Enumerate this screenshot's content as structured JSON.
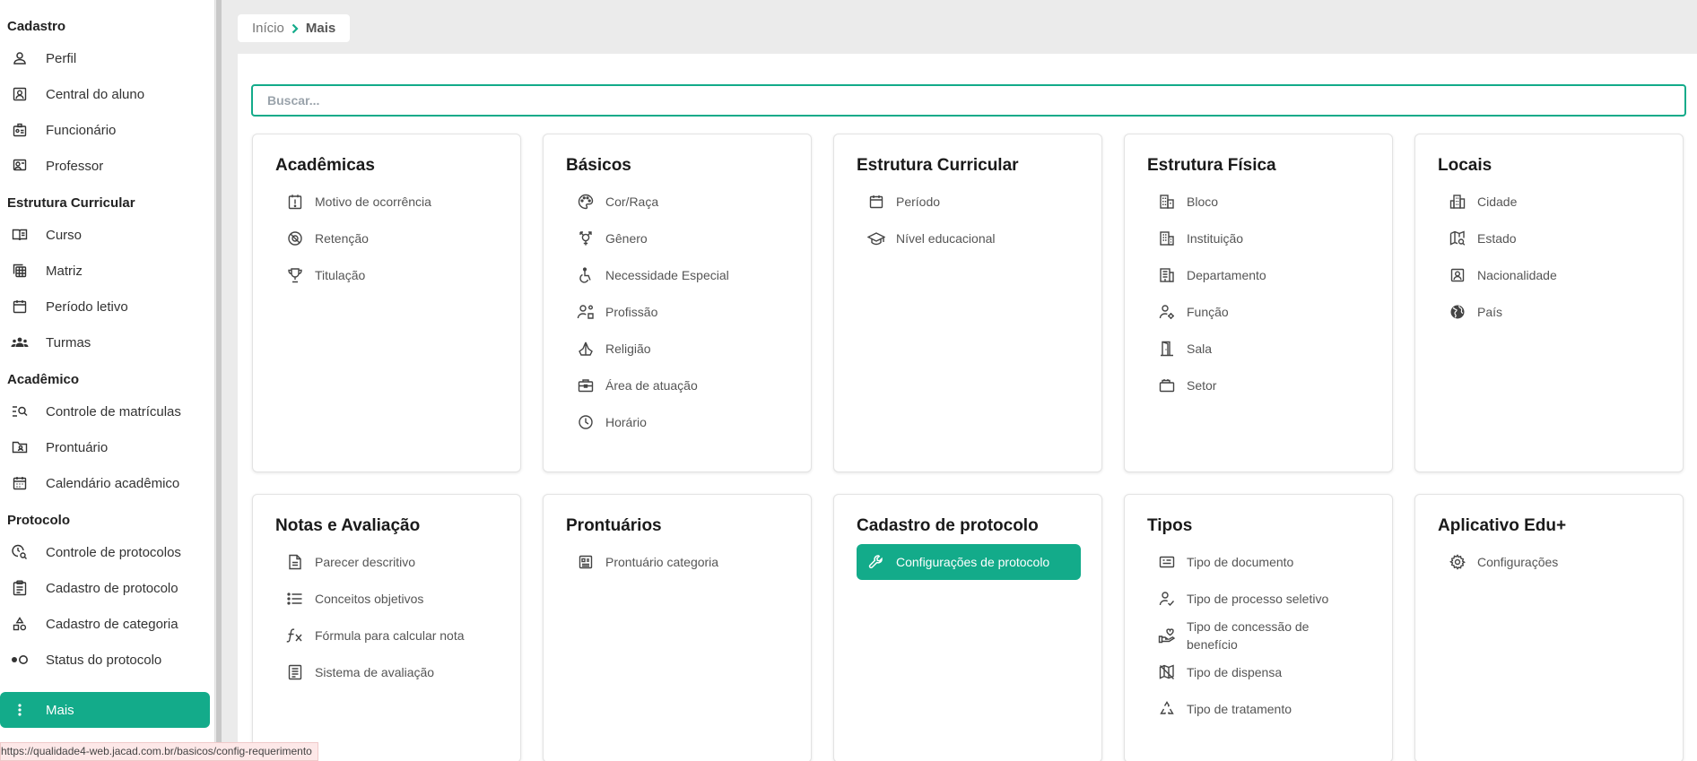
{
  "sidebar": {
    "sections": [
      {
        "title": "Cadastro",
        "items": [
          {
            "label": "Perfil",
            "icon": "person-icon"
          },
          {
            "label": "Central do aluno",
            "icon": "student-portrait-icon"
          },
          {
            "label": "Funcionário",
            "icon": "badge-icon"
          },
          {
            "label": "Professor",
            "icon": "teacher-icon"
          }
        ]
      },
      {
        "title": "Estrutura Curricular",
        "items": [
          {
            "label": "Curso",
            "icon": "book-open-icon"
          },
          {
            "label": "Matriz",
            "icon": "grid-stack-icon"
          },
          {
            "label": "Período letivo",
            "icon": "calendar-icon"
          },
          {
            "label": "Turmas",
            "icon": "group-icon"
          }
        ]
      },
      {
        "title": "Acadêmico",
        "items": [
          {
            "label": "Controle de matrículas",
            "icon": "list-search-icon"
          },
          {
            "label": "Prontuário",
            "icon": "folder-user-icon"
          },
          {
            "label": "Calendário acadêmico",
            "icon": "calendar-grid-icon"
          }
        ]
      },
      {
        "title": "Protocolo",
        "items": [
          {
            "label": "Controle de protocolos",
            "icon": "clock-search-icon"
          },
          {
            "label": "Cadastro de protocolo",
            "icon": "clipboard-icon"
          },
          {
            "label": "Cadastro de categoria",
            "icon": "shapes-icon"
          },
          {
            "label": "Status do protocolo",
            "icon": "toggle-dots-icon"
          }
        ]
      }
    ],
    "active": {
      "label": "Mais",
      "icon": "more-vertical-icon"
    }
  },
  "breadcrumb": {
    "home": "Início",
    "current": "Mais"
  },
  "search": {
    "placeholder": "Buscar..."
  },
  "cards": [
    {
      "title": "Acadêmicas",
      "items": [
        {
          "label": "Motivo de ocorrência",
          "icon": "alert-square-icon"
        },
        {
          "label": "Retenção",
          "icon": "blocked-circle-icon"
        },
        {
          "label": "Titulação",
          "icon": "trophy-icon"
        }
      ]
    },
    {
      "title": "Básicos",
      "items": [
        {
          "label": "Cor/Raça",
          "icon": "palette-icon"
        },
        {
          "label": "Gênero",
          "icon": "gender-icon"
        },
        {
          "label": "Necessidade Especial",
          "icon": "accessibility-icon"
        },
        {
          "label": "Profissão",
          "icon": "person-work-icon"
        },
        {
          "label": "Religião",
          "icon": "praying-hands-icon"
        },
        {
          "label": "Área de atuação",
          "icon": "toolbox-icon"
        },
        {
          "label": "Horário",
          "icon": "clock-icon"
        }
      ]
    },
    {
      "title": "Estrutura Curricular",
      "items": [
        {
          "label": "Período",
          "icon": "calendar-icon"
        },
        {
          "label": "Nível educacional",
          "icon": "graduation-cap-icon"
        }
      ]
    },
    {
      "title": "Estrutura Física",
      "items": [
        {
          "label": "Bloco",
          "icon": "buildings-icon"
        },
        {
          "label": "Instituição",
          "icon": "building-icon"
        },
        {
          "label": "Departamento",
          "icon": "office-building-icon"
        },
        {
          "label": "Função",
          "icon": "person-gear-icon"
        },
        {
          "label": "Sala",
          "icon": "door-icon"
        },
        {
          "label": "Setor",
          "icon": "stacked-cards-icon"
        }
      ]
    },
    {
      "title": "Locais",
      "items": [
        {
          "label": "Cidade",
          "icon": "city-icon"
        },
        {
          "label": "Estado",
          "icon": "map-search-icon"
        },
        {
          "label": "Nacionalidade",
          "icon": "id-portrait-icon"
        },
        {
          "label": "País",
          "icon": "globe-icon"
        }
      ]
    },
    {
      "title": "Notas e Avaliação",
      "items": [
        {
          "label": "Parecer descritivo",
          "icon": "document-icon"
        },
        {
          "label": "Conceitos objetivos",
          "icon": "list-icon"
        },
        {
          "label": "Fórmula para calcular nota",
          "icon": "function-icon"
        },
        {
          "label": "Sistema de avaliação",
          "icon": "document-lines-icon"
        }
      ]
    },
    {
      "title": "Prontuários",
      "items": [
        {
          "label": "Prontuário categoria",
          "icon": "id-card-icon"
        }
      ]
    },
    {
      "title": "Cadastro de protocolo",
      "items": [
        {
          "label": "Configurações de protocolo",
          "icon": "wrench-icon",
          "active": true
        }
      ]
    },
    {
      "title": "Tipos",
      "items": [
        {
          "label": "Tipo de documento",
          "icon": "card-lines-icon"
        },
        {
          "label": "Tipo de processo seletivo",
          "icon": "person-check-icon"
        },
        {
          "label": "Tipo de concessão de benefício",
          "icon": "hand-heart-icon"
        },
        {
          "label": "Tipo de dispensa",
          "icon": "map-off-icon"
        },
        {
          "label": "Tipo de tratamento",
          "icon": "recycle-icon"
        }
      ]
    },
    {
      "title": "Aplicativo Edu+",
      "items": [
        {
          "label": "Configurações",
          "icon": "gear-icon"
        }
      ]
    }
  ],
  "status_url": "https://qualidade4-web.jacad.com.br/basicos/config-requerimento",
  "colors": {
    "accent": "#13ab8a",
    "background": "#ebebeb"
  }
}
